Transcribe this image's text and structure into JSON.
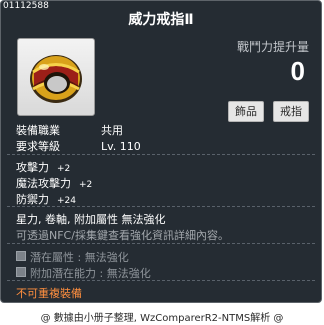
{
  "tooltip": {
    "item_id": "01112588",
    "item_name": "威力戒指Ⅱ",
    "power_label": "戰鬥力提升量",
    "power_value": "0",
    "tags": [
      "飾品",
      "戒指"
    ],
    "requirements": [
      {
        "key": "裝備職業",
        "value": "共用"
      },
      {
        "key": "要求等級",
        "value": "Lv. 110"
      }
    ],
    "stats": [
      {
        "key": "攻擊力",
        "value": "+2"
      },
      {
        "key": "魔法攻擊力",
        "value": "+2"
      },
      {
        "key": "防禦力",
        "value": "+24"
      }
    ],
    "traits": "星力, 卷軸, 附加屬性 無法強化",
    "info": "可透過NFC/採集鍵查看強化資訊詳細內容。",
    "potentials": [
      {
        "key": "潛在屬性",
        "value": "無法強化"
      },
      {
        "key": "附加潛在能力",
        "value": "無法強化"
      }
    ],
    "warning": "不可重複裝備",
    "colors": {
      "background": "#252c33",
      "warning": "#ff8f3f",
      "ring_gold": "#d9a21b",
      "ring_red": "#9c1f18"
    },
    "icon": "ring-icon"
  },
  "footer": {
    "credit": "@ 數據由小册子整理, WzComparerR2-NTMS解析 @"
  }
}
